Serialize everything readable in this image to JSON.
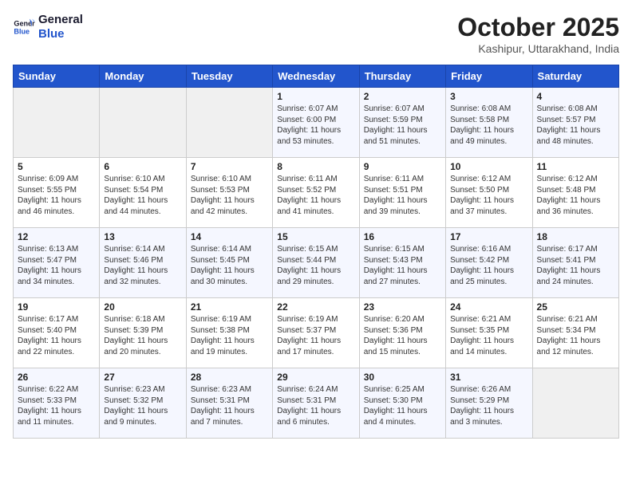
{
  "header": {
    "logo_line1": "General",
    "logo_line2": "Blue",
    "month": "October 2025",
    "location": "Kashipur, Uttarakhand, India"
  },
  "days_of_week": [
    "Sunday",
    "Monday",
    "Tuesday",
    "Wednesday",
    "Thursday",
    "Friday",
    "Saturday"
  ],
  "weeks": [
    [
      {
        "day": "",
        "empty": true
      },
      {
        "day": "",
        "empty": true
      },
      {
        "day": "",
        "empty": true
      },
      {
        "day": "1",
        "sunrise": "6:07 AM",
        "sunset": "6:00 PM",
        "daylight": "11 hours and 53 minutes."
      },
      {
        "day": "2",
        "sunrise": "6:07 AM",
        "sunset": "5:59 PM",
        "daylight": "11 hours and 51 minutes."
      },
      {
        "day": "3",
        "sunrise": "6:08 AM",
        "sunset": "5:58 PM",
        "daylight": "11 hours and 49 minutes."
      },
      {
        "day": "4",
        "sunrise": "6:08 AM",
        "sunset": "5:57 PM",
        "daylight": "11 hours and 48 minutes."
      }
    ],
    [
      {
        "day": "5",
        "sunrise": "6:09 AM",
        "sunset": "5:55 PM",
        "daylight": "11 hours and 46 minutes."
      },
      {
        "day": "6",
        "sunrise": "6:10 AM",
        "sunset": "5:54 PM",
        "daylight": "11 hours and 44 minutes."
      },
      {
        "day": "7",
        "sunrise": "6:10 AM",
        "sunset": "5:53 PM",
        "daylight": "11 hours and 42 minutes."
      },
      {
        "day": "8",
        "sunrise": "6:11 AM",
        "sunset": "5:52 PM",
        "daylight": "11 hours and 41 minutes."
      },
      {
        "day": "9",
        "sunrise": "6:11 AM",
        "sunset": "5:51 PM",
        "daylight": "11 hours and 39 minutes."
      },
      {
        "day": "10",
        "sunrise": "6:12 AM",
        "sunset": "5:50 PM",
        "daylight": "11 hours and 37 minutes."
      },
      {
        "day": "11",
        "sunrise": "6:12 AM",
        "sunset": "5:48 PM",
        "daylight": "11 hours and 36 minutes."
      }
    ],
    [
      {
        "day": "12",
        "sunrise": "6:13 AM",
        "sunset": "5:47 PM",
        "daylight": "11 hours and 34 minutes."
      },
      {
        "day": "13",
        "sunrise": "6:14 AM",
        "sunset": "5:46 PM",
        "daylight": "11 hours and 32 minutes."
      },
      {
        "day": "14",
        "sunrise": "6:14 AM",
        "sunset": "5:45 PM",
        "daylight": "11 hours and 30 minutes."
      },
      {
        "day": "15",
        "sunrise": "6:15 AM",
        "sunset": "5:44 PM",
        "daylight": "11 hours and 29 minutes."
      },
      {
        "day": "16",
        "sunrise": "6:15 AM",
        "sunset": "5:43 PM",
        "daylight": "11 hours and 27 minutes."
      },
      {
        "day": "17",
        "sunrise": "6:16 AM",
        "sunset": "5:42 PM",
        "daylight": "11 hours and 25 minutes."
      },
      {
        "day": "18",
        "sunrise": "6:17 AM",
        "sunset": "5:41 PM",
        "daylight": "11 hours and 24 minutes."
      }
    ],
    [
      {
        "day": "19",
        "sunrise": "6:17 AM",
        "sunset": "5:40 PM",
        "daylight": "11 hours and 22 minutes."
      },
      {
        "day": "20",
        "sunrise": "6:18 AM",
        "sunset": "5:39 PM",
        "daylight": "11 hours and 20 minutes."
      },
      {
        "day": "21",
        "sunrise": "6:19 AM",
        "sunset": "5:38 PM",
        "daylight": "11 hours and 19 minutes."
      },
      {
        "day": "22",
        "sunrise": "6:19 AM",
        "sunset": "5:37 PM",
        "daylight": "11 hours and 17 minutes."
      },
      {
        "day": "23",
        "sunrise": "6:20 AM",
        "sunset": "5:36 PM",
        "daylight": "11 hours and 15 minutes."
      },
      {
        "day": "24",
        "sunrise": "6:21 AM",
        "sunset": "5:35 PM",
        "daylight": "11 hours and 14 minutes."
      },
      {
        "day": "25",
        "sunrise": "6:21 AM",
        "sunset": "5:34 PM",
        "daylight": "11 hours and 12 minutes."
      }
    ],
    [
      {
        "day": "26",
        "sunrise": "6:22 AM",
        "sunset": "5:33 PM",
        "daylight": "11 hours and 11 minutes."
      },
      {
        "day": "27",
        "sunrise": "6:23 AM",
        "sunset": "5:32 PM",
        "daylight": "11 hours and 9 minutes."
      },
      {
        "day": "28",
        "sunrise": "6:23 AM",
        "sunset": "5:31 PM",
        "daylight": "11 hours and 7 minutes."
      },
      {
        "day": "29",
        "sunrise": "6:24 AM",
        "sunset": "5:31 PM",
        "daylight": "11 hours and 6 minutes."
      },
      {
        "day": "30",
        "sunrise": "6:25 AM",
        "sunset": "5:30 PM",
        "daylight": "11 hours and 4 minutes."
      },
      {
        "day": "31",
        "sunrise": "6:26 AM",
        "sunset": "5:29 PM",
        "daylight": "11 hours and 3 minutes."
      },
      {
        "day": "",
        "empty": true
      }
    ]
  ],
  "labels": {
    "sunrise": "Sunrise:",
    "sunset": "Sunset:",
    "daylight": "Daylight:"
  }
}
